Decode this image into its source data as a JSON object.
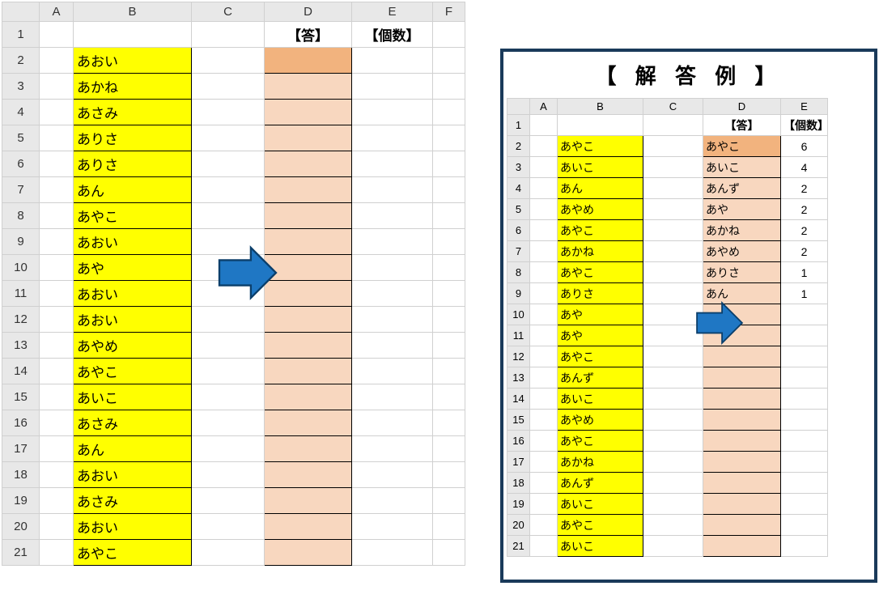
{
  "main": {
    "columns": [
      "A",
      "B",
      "C",
      "D",
      "E",
      "F"
    ],
    "header_D": "【答】",
    "header_E": "【個数】",
    "rows": 21,
    "colB": [
      "あおい",
      "あかね",
      "あさみ",
      "ありさ",
      "ありさ",
      "あん",
      "あやこ",
      "あおい",
      "あや",
      "あおい",
      "あおい",
      "あやめ",
      "あやこ",
      "あいこ",
      "あさみ",
      "あん",
      "あおい",
      "あさみ",
      "あおい",
      "あやこ"
    ]
  },
  "arrow_color_fill": "#1f77c4",
  "arrow_color_stroke": "#0b3f6b",
  "panel": {
    "title": "【 解 答 例 】",
    "columns": [
      "A",
      "B",
      "C",
      "D",
      "E"
    ],
    "header_D": "【答】",
    "header_E": "【個数】",
    "rows": 21,
    "colB": [
      "あやこ",
      "あいこ",
      "あん",
      "あやめ",
      "あやこ",
      "あかね",
      "あやこ",
      "ありさ",
      "あや",
      "あや",
      "あやこ",
      "あんず",
      "あいこ",
      "あやめ",
      "あやこ",
      "あかね",
      "あんず",
      "あいこ",
      "あやこ",
      "あいこ"
    ],
    "answers": [
      {
        "name": "あやこ",
        "count": 6
      },
      {
        "name": "あいこ",
        "count": 4
      },
      {
        "name": "あんず",
        "count": 2
      },
      {
        "name": "あや",
        "count": 2
      },
      {
        "name": "あかね",
        "count": 2
      },
      {
        "name": "あやめ",
        "count": 2
      },
      {
        "name": "ありさ",
        "count": 1
      },
      {
        "name": "あん",
        "count": 1
      }
    ]
  }
}
